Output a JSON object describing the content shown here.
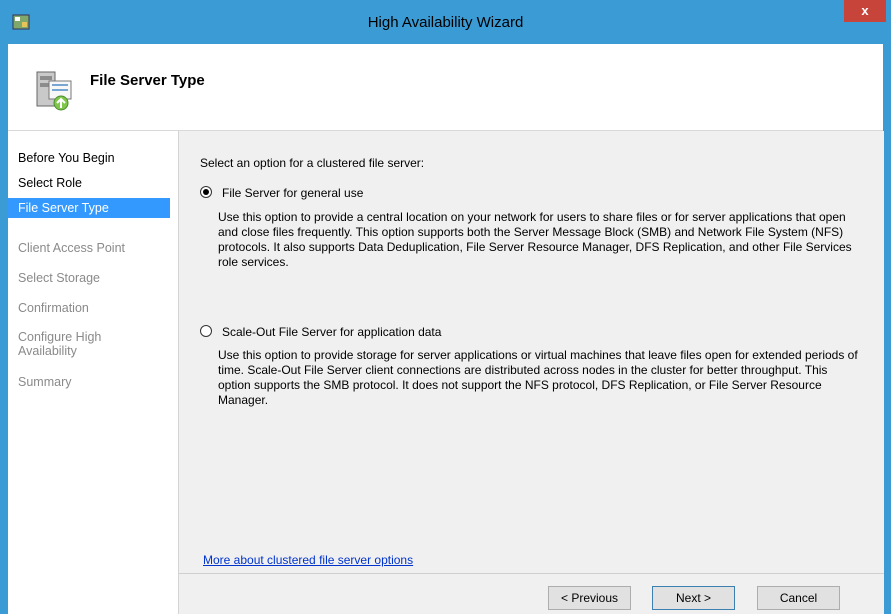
{
  "window": {
    "title": "High Availability Wizard",
    "close_label": "x"
  },
  "header": {
    "title": "File Server Type"
  },
  "sidebar": {
    "items": [
      {
        "label": "Before You Begin",
        "state": "normal"
      },
      {
        "label": "Select Role",
        "state": "normal"
      },
      {
        "label": "File Server Type",
        "state": "selected"
      },
      {
        "label": "Client Access Point",
        "state": "disabled"
      },
      {
        "label": "Select Storage",
        "state": "disabled"
      },
      {
        "label": "Confirmation",
        "state": "disabled"
      },
      {
        "label": "Configure High\nAvailability",
        "state": "disabled"
      },
      {
        "label": "Summary",
        "state": "disabled"
      }
    ]
  },
  "main": {
    "prompt": "Select an option for a clustered file server:",
    "options": [
      {
        "label": "File Server for general use",
        "checked": true,
        "description": "Use this option to provide a central location on your network for users to share files or for server applications that open and close files frequently. This option supports both the Server Message Block (SMB) and Network File System (NFS) protocols. It also supports Data Deduplication, File Server Resource Manager, DFS Replication, and other File Services role services."
      },
      {
        "label": "Scale-Out File Server for application data",
        "checked": false,
        "description": "Use this option to provide storage for server applications or virtual machines that leave files open for extended periods of time. Scale-Out File Server client connections are distributed across nodes in the cluster for better throughput. This option supports the SMB protocol. It does not support the NFS protocol, DFS Replication, or File Server Resource Manager."
      }
    ],
    "link": "More about clustered file server options"
  },
  "footer": {
    "previous_label": "< Previous",
    "next_label": "Next >",
    "cancel_label": "Cancel"
  },
  "colors": {
    "title_bar": "#3b9bd4",
    "selected_nav": "#3399ff",
    "close_button": "#c7443a",
    "link": "#0033cc"
  }
}
